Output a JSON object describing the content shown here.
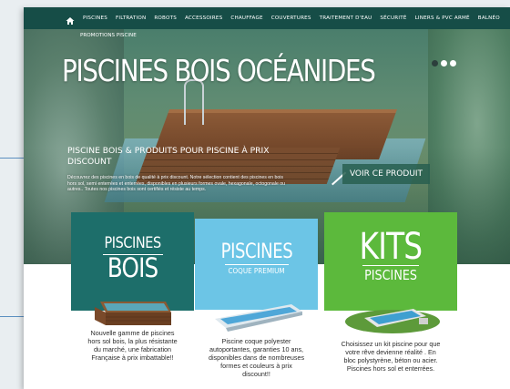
{
  "nav": {
    "items": [
      "PISCINES",
      "FILTRATION",
      "ROBOTS",
      "ACCESSOIRES",
      "CHAUFFAGE",
      "COUVERTURES",
      "TRAITEMENT D'EAU",
      "SÉCURITÉ",
      "LINERS & PVC ARMÉ",
      "BALNÉO"
    ]
  },
  "hero": {
    "promo": "PROMOTIONS PISCINE",
    "title": "PISCINES BOIS OCÉANIDES",
    "subtitle": "PISCINE BOIS & PRODUITS POUR PISCINE À PRIX DISCOUNT",
    "description": "Découvrez des piscines en bois de qualité à prix discount. Notre sélection contient des piscines en bois hors sol, semi enterrées et enterrées, disponibles en plusieurs formes ovale, hexagonale, octogonale ou autres.. Toutes nos piscines bois sont certifiés et résiste au temps.",
    "cta": "VOIR CE PRODUIT",
    "slides": 3,
    "active_slide": 1
  },
  "cards": [
    {
      "title_line1": "PISCINES",
      "title_line2": "BOIS",
      "text": "Nouvelle gamme de piscines hors sol bois, la plus résistante du marché, une fabrication Française à prix imbattable!!"
    },
    {
      "title_line1": "PISCINES",
      "title_line2": "COQUE PREMIUM",
      "text": "Piscine coque polyester autoportantes, garanties 10 ans, disponibles dans de nombreuses formes et couleurs à prix discount!!"
    },
    {
      "title_line1": "KITS",
      "title_line2": "PISCINES",
      "text": "Choisissez un kit piscine pour que votre rêve devienne réalité . En bloc polystyrène, béton ou acier. Piscines hors sol et enterrées."
    }
  ],
  "colors": {
    "nav_bg": "#164d47",
    "card_bois": "#1d6e6a",
    "card_coque": "#6cc5e6",
    "card_kits": "#5cb93c"
  },
  "icons": [
    "home-icon",
    "arrow-icon"
  ]
}
